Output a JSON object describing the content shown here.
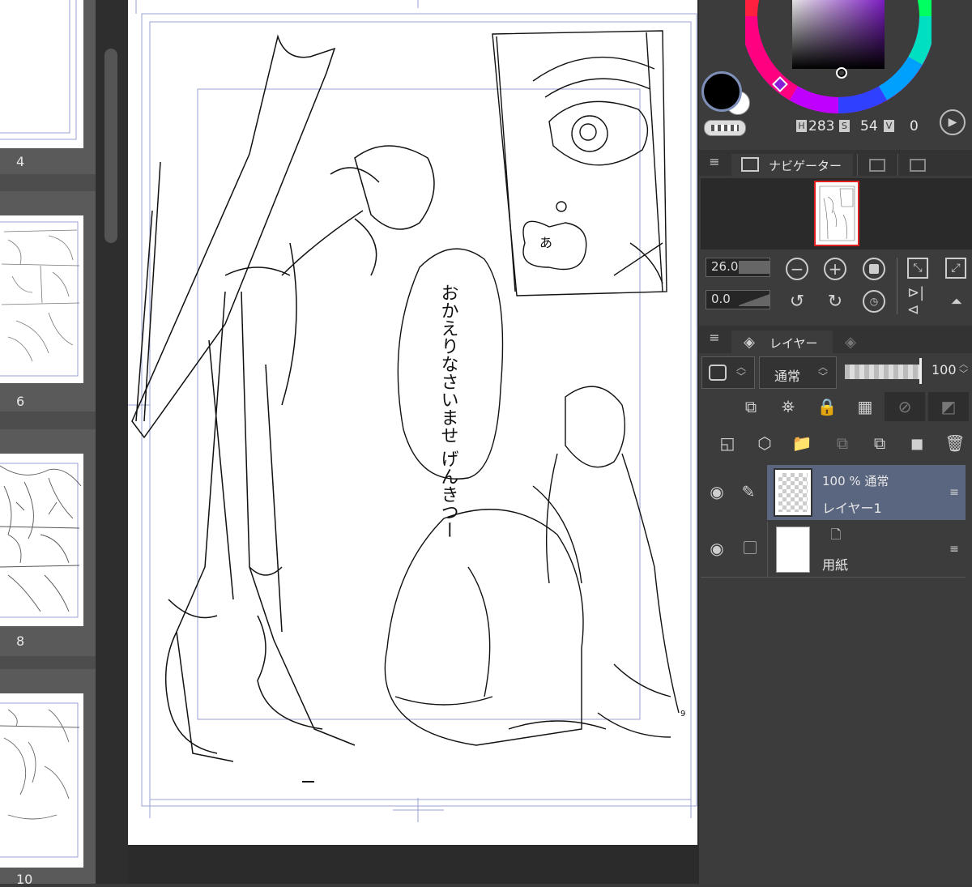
{
  "page_strip": {
    "pages": [
      {
        "number": "4"
      },
      {
        "number": "6"
      },
      {
        "number": "8"
      },
      {
        "number": "10"
      }
    ]
  },
  "canvas": {
    "page_number": "9",
    "speech_bubble_text": "おかえりなさいませ げんきつー",
    "thought_bubble_text": "あ"
  },
  "color_panel": {
    "h_label": "H",
    "h_value": "283",
    "s_label": "S",
    "s_value": "54",
    "v_label": "V",
    "v_value": "0",
    "main_color": "#000000",
    "sub_color": "#ffffff"
  },
  "navigator": {
    "tab_label": "ナビゲーター",
    "zoom_value": "26.0",
    "rotation_value": "0.0"
  },
  "layers": {
    "tab_label": "レイヤー",
    "blend_mode": "通常",
    "opacity": "100",
    "items": [
      {
        "summary": "100 % 通常",
        "name": "レイヤー1",
        "selected": true
      },
      {
        "summary": "",
        "name": "用紙",
        "selected": false
      }
    ]
  },
  "colors": {
    "accent_selected_row": "#5a6680",
    "panel_bg": "#3c3c3c"
  }
}
